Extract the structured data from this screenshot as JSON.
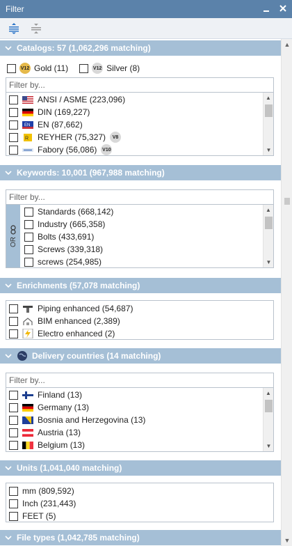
{
  "window": {
    "title": "Filter"
  },
  "catalogs": {
    "header": "Catalogs: 57 (1,062,296 matching)",
    "gold": {
      "badge": "V12",
      "label": "Gold (11)"
    },
    "silver": {
      "badge": "V12",
      "label": "Silver (8)"
    },
    "filter_placeholder": "Filter by...",
    "items": [
      {
        "label": "ANSI / ASME (223,096)",
        "icon": "us-flag-icon"
      },
      {
        "label": "DIN (169,227)",
        "icon": "german-flag-icon"
      },
      {
        "label": "EN (87,662)",
        "icon": "eu-flag-icon"
      },
      {
        "label": "REYHER (75,327)",
        "icon": "reyher-logo-icon",
        "badge": "V8"
      },
      {
        "label": "Fabory (56,086)",
        "icon": "fabory-logo-icon",
        "badge": "V10"
      }
    ]
  },
  "keywords": {
    "header": "Keywords: 10,001 (967,988 matching)",
    "filter_placeholder": "Filter by...",
    "or_label": "OR",
    "items": [
      {
        "label": "Standards (668,142)"
      },
      {
        "label": "Industry (665,358)"
      },
      {
        "label": "Bolts (433,691)"
      },
      {
        "label": "Screws (339,318)"
      },
      {
        "label": "screws (254,985)"
      }
    ]
  },
  "enrichments": {
    "header": "Enrichments (57,078 matching)",
    "items": [
      {
        "label": "Piping enhanced (54,687)",
        "icon": "piping-icon"
      },
      {
        "label": "BIM enhanced (2,389)",
        "icon": "bim-building-icon"
      },
      {
        "label": "Electro enhanced (2)",
        "icon": "lightning-icon"
      }
    ]
  },
  "delivery": {
    "header": "Delivery countries (14 matching)",
    "filter_placeholder": "Filter by...",
    "items": [
      {
        "label": "Finland (13)",
        "icon": "finland-flag-icon"
      },
      {
        "label": "Germany (13)",
        "icon": "germany-flag-icon"
      },
      {
        "label": "Bosnia and Herzegovina (13)",
        "icon": "bosnia-flag-icon"
      },
      {
        "label": "Austria (13)",
        "icon": "austria-flag-icon"
      },
      {
        "label": "Belgium (13)",
        "icon": "belgium-flag-icon"
      }
    ]
  },
  "units": {
    "header": "Units (1,041,040 matching)",
    "items": [
      {
        "label": "mm (809,592)"
      },
      {
        "label": "Inch (231,443)"
      },
      {
        "label": "FEET (5)"
      }
    ]
  },
  "filetypes": {
    "header": "File types (1,042,785 matching)"
  },
  "colors": {
    "titlebar": "#5b82aa",
    "section_header": "#a5bfd6",
    "gold": "#e5b94a"
  }
}
